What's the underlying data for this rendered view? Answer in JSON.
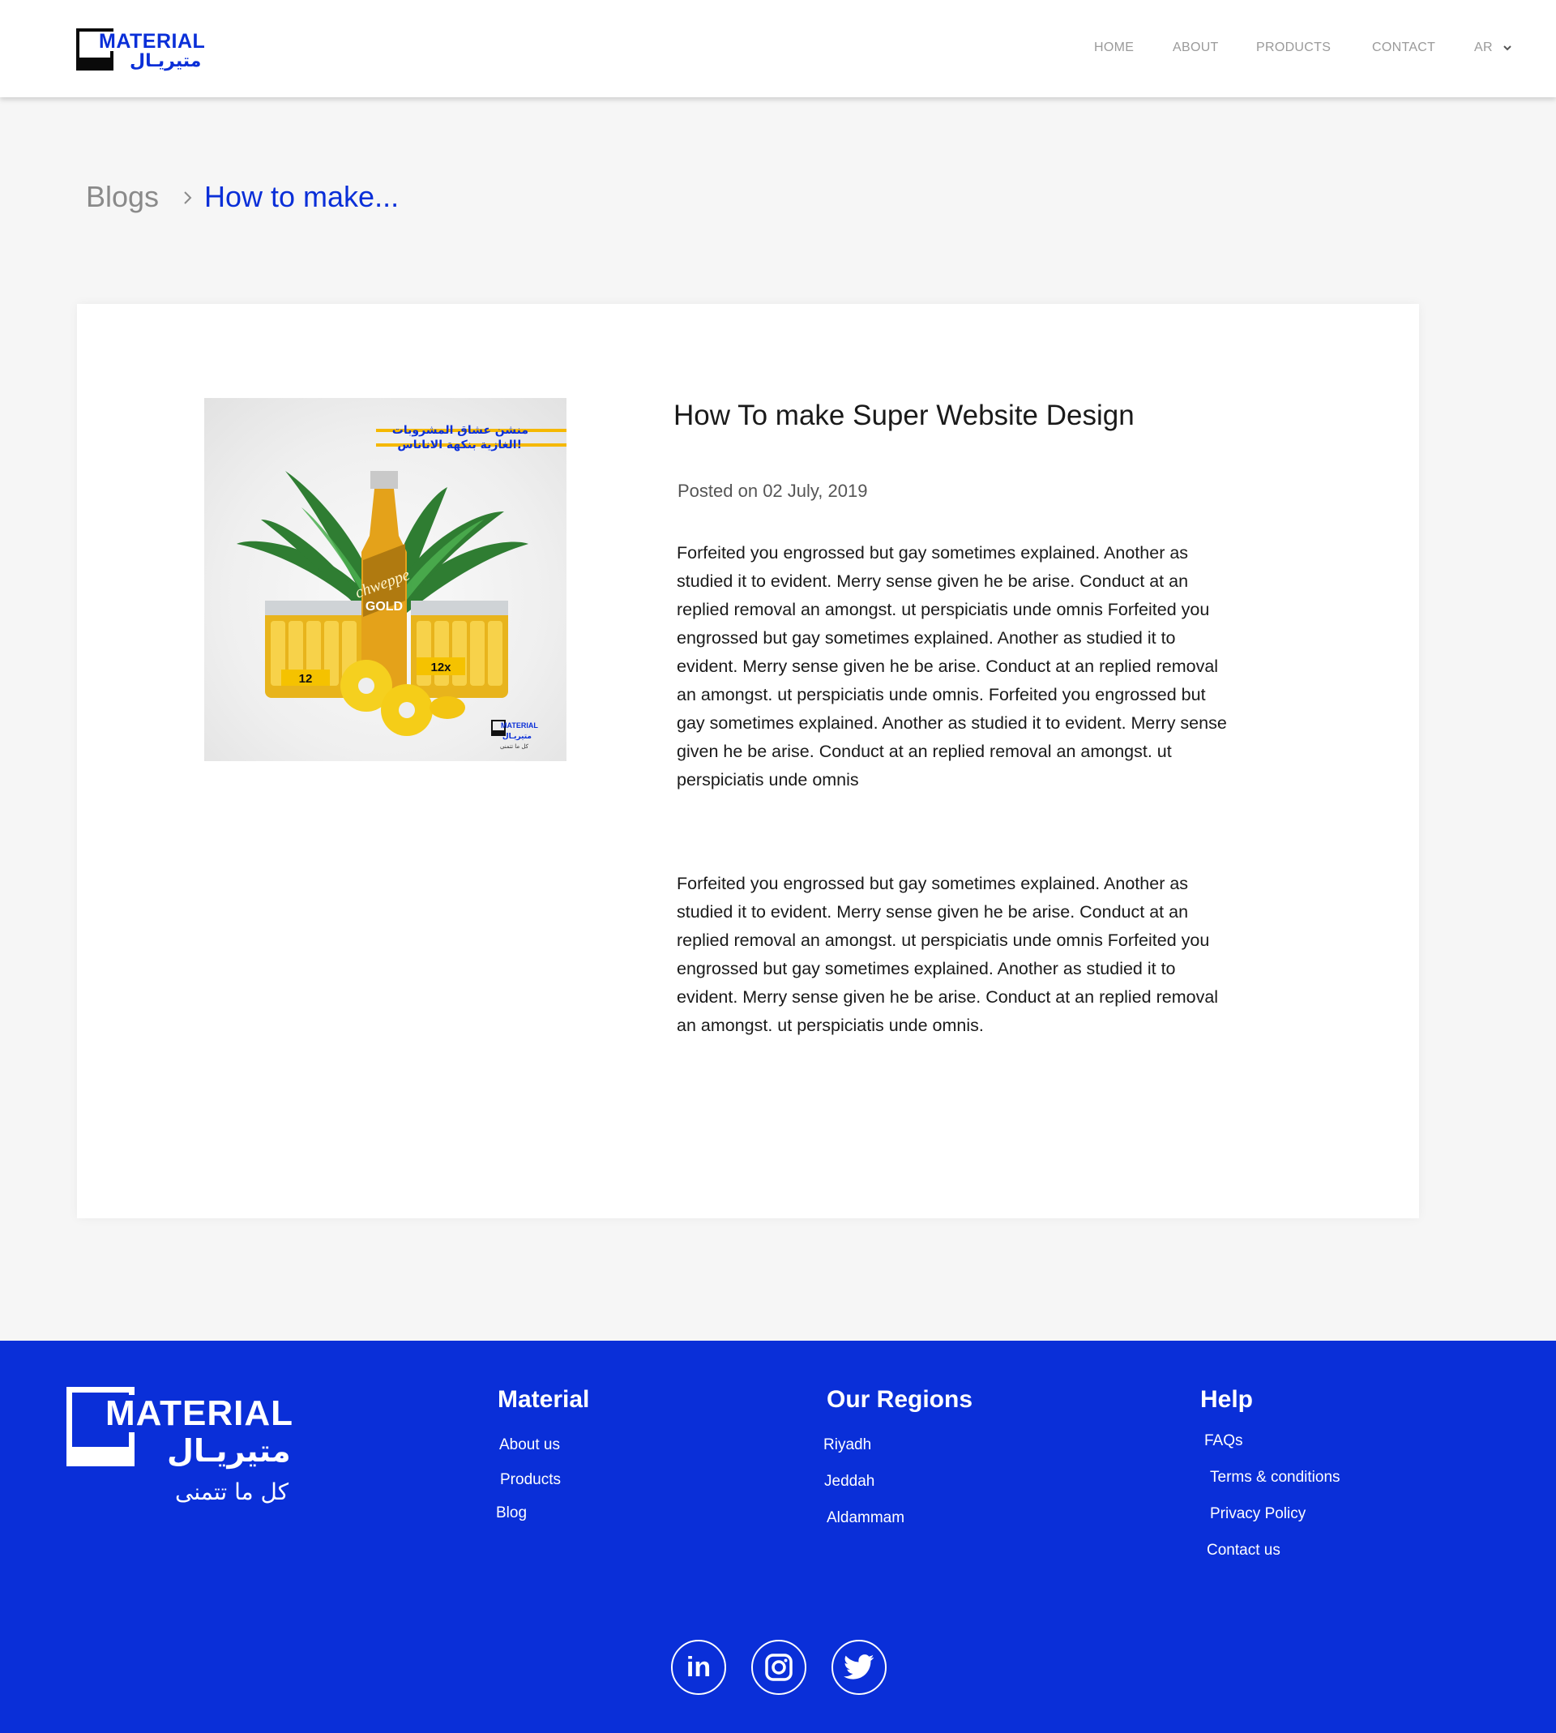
{
  "brand": {
    "name_en": "MATERIAL",
    "name_ar": "متيريـال",
    "tagline_ar": "كل ما تتمنى",
    "accent_color": "#0a2fd8"
  },
  "nav": {
    "items": [
      {
        "label": "HOME"
      },
      {
        "label": "ABOUT"
      },
      {
        "label": "PRODUCTS"
      },
      {
        "label": "CONTACT"
      }
    ],
    "language": "AR",
    "language_icon": "chevron-down-icon"
  },
  "breadcrumb": {
    "parent": "Blogs",
    "separator_icon": "chevron-right-icon",
    "current": "How to make..."
  },
  "post": {
    "title": "How To make Super Website Design",
    "date": "Posted on 02 July, 2019",
    "paragraphs": [
      "Forfeited you engrossed but gay sometimes explained. Another as studied it to evident. Merry sense given he be arise. Conduct at an replied removal an amongst. ut perspiciatis unde omnis Forfeited you engrossed but gay sometimes explained. Another as studied it to evident. Merry sense given he be arise. Conduct at an replied removal an amongst. ut perspiciatis unde omnis. Forfeited you engrossed but gay sometimes explained. Another as studied it to evident. Merry sense given he be arise. Conduct at an replied removal an amongst. ut perspiciatis unde omnis",
      "Forfeited you engrossed but gay sometimes explained. Another as studied it to evident. Merry sense given he be arise. Conduct at an replied removal an amongst. ut perspiciatis unde omnis Forfeited you engrossed but gay sometimes explained. Another as studied it to evident. Merry sense given he be arise. Conduct at an replied removal an amongst. ut perspiciatis unde omnis."
    ],
    "image": {
      "headline_ar_1": "منشن عشاق المشروبات",
      "headline_ar_2": "الغازية بنكهة الاناناس!",
      "bottle_brand": "chweppe",
      "bottle_label": "GOLD",
      "pack_label": "12x",
      "logo_en": "MATERIAL",
      "logo_ar": "متيريـال",
      "logo_tag_ar": "كل ما تتمنى"
    }
  },
  "footer": {
    "columns": [
      {
        "title": "Material",
        "links": [
          "About us",
          "Products",
          "Blog"
        ]
      },
      {
        "title": "Our Regions",
        "links": [
          "Riyadh",
          "Jeddah",
          "Aldammam"
        ]
      },
      {
        "title": "Help",
        "links": [
          "FAQs",
          "Terms & conditions",
          "Privacy Policy",
          "Contact us"
        ]
      }
    ],
    "social": [
      {
        "icon": "linkedin-icon",
        "text": "in"
      },
      {
        "icon": "instagram-icon"
      },
      {
        "icon": "twitter-icon"
      }
    ]
  }
}
